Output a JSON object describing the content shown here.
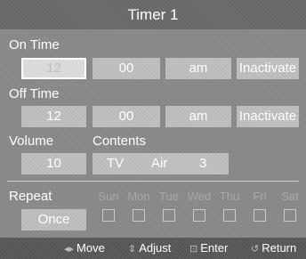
{
  "title": "Timer 1",
  "on_time": {
    "label": "On Time",
    "hour": "12",
    "minute": "00",
    "ampm": "am",
    "status": "Inactivate"
  },
  "off_time": {
    "label": "Off Time",
    "hour": "12",
    "minute": "00",
    "ampm": "am",
    "status": "Inactivate"
  },
  "volume": {
    "label": "Volume",
    "value": "10"
  },
  "contents": {
    "label": "Contents",
    "source": "TV",
    "band": "Air",
    "channel": "3"
  },
  "repeat": {
    "label": "Repeat",
    "value": "Once",
    "days": [
      "Sun",
      "Mon",
      "Tue",
      "Wed",
      "Thu",
      "Fri",
      "Sat"
    ]
  },
  "footer": {
    "move": {
      "icon": "move-arrows-icon",
      "label": "Move"
    },
    "adjust": {
      "icon": "adjust-arrows-icon",
      "label": "Adjust"
    },
    "enter": {
      "icon": "enter-icon",
      "label": "Enter"
    },
    "return": {
      "icon": "return-icon",
      "label": "Return"
    }
  }
}
